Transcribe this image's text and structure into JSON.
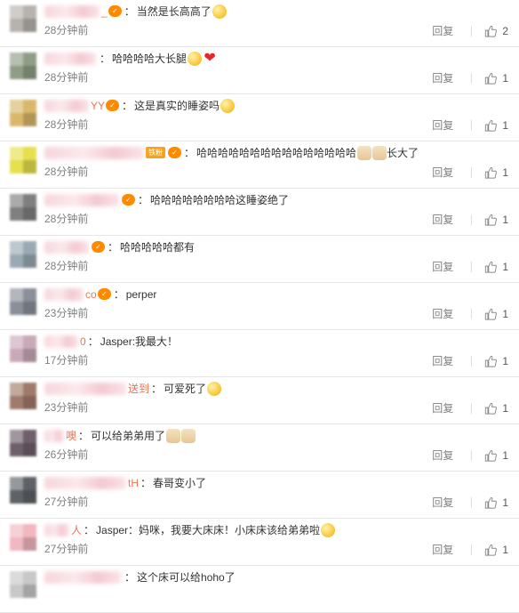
{
  "comments": [
    {
      "name_tail": "_",
      "badge": "✓",
      "text": "当然是长高高了",
      "emoji": [
        "face"
      ],
      "time": "28分钟前",
      "reply": "回复",
      "likes": "2",
      "avatar": "#b7b2ad",
      "name_w": 62
    },
    {
      "name_tail": "",
      "badge": "",
      "text": "哈哈哈哈大长腿",
      "emoji": [
        "face",
        "heart"
      ],
      "time": "28分钟前",
      "reply": "回复",
      "likes": "1",
      "avatar": "#8f9d86",
      "name_w": 58
    },
    {
      "name_tail": "YY",
      "badge": "✓",
      "text": "这是真实的睡姿吗",
      "emoji": [
        "face"
      ],
      "time": "28分钟前",
      "reply": "回复",
      "likes": "1",
      "avatar": "#d9b86b",
      "name_w": 50
    },
    {
      "name_tail": "",
      "badge": "✓",
      "fan": "铁粉",
      "text": "哈哈哈哈哈哈哈哈哈哈哈哈哈哈哈",
      "emoji": [
        "cat",
        "cat"
      ],
      "after": "长大了",
      "time": "28分钟前",
      "reply": "回复",
      "likes": "1",
      "avatar": "#e6e04e",
      "name_w": 112
    },
    {
      "name_tail": "",
      "badge": "✓",
      "text": "哈哈哈哈哈哈哈哈这睡姿绝了",
      "emoji": [],
      "time": "28分钟前",
      "reply": "回复",
      "likes": "1",
      "avatar": "#7f7f7f",
      "name_w": 84
    },
    {
      "name_tail": "",
      "badge": "✓",
      "text": "哈哈哈哈哈都有",
      "emoji": [],
      "time": "28分钟前",
      "reply": "回复",
      "likes": "1",
      "avatar": "#9aa9b3",
      "name_w": 50
    },
    {
      "name_tail": "co",
      "badge": "✓",
      "text": "perper",
      "emoji": [],
      "time": "23分钟前",
      "reply": "回复",
      "likes": "1",
      "avatar": "#8a8f99",
      "name_w": 44
    },
    {
      "name_tail": "0",
      "badge": "",
      "text": "Jasper:我最大！",
      "emoji": [],
      "time": "17分钟前",
      "reply": "回复",
      "likes": "1",
      "avatar": "#c9a9b8",
      "name_w": 38
    },
    {
      "name_tail": "送到",
      "badge": "",
      "text": "可爱死了",
      "emoji": [
        "face"
      ],
      "time": "23分钟前",
      "reply": "回复",
      "likes": "1",
      "avatar": "#a07b6b",
      "name_w": 92
    },
    {
      "name_tail": "噢",
      "badge": "",
      "text": "可以给弟弟用了",
      "emoji": [
        "cat",
        "cat"
      ],
      "time": "26分钟前",
      "reply": "回复",
      "likes": "1",
      "avatar": "#6e5f6b",
      "name_w": 22
    },
    {
      "name_tail": "tH",
      "badge": "",
      "text": "春哥变小了",
      "emoji": [],
      "time": "27分钟前",
      "reply": "回复",
      "likes": "1",
      "avatar": "#5e6266",
      "name_w": 92
    },
    {
      "name_tail": "人",
      "badge": "",
      "text": "Jasper：妈咪，我要大床床！小床床该给弟弟啦",
      "emoji": [
        "face"
      ],
      "time": "27分钟前",
      "reply": "回复",
      "likes": "1",
      "avatar": "#f2b7c0",
      "name_w": 28
    },
    {
      "name_tail": "",
      "badge": "",
      "text": "这个床可以给hoho了",
      "emoji": [],
      "time": "",
      "reply": "",
      "likes": "",
      "avatar": "#c8c8c8",
      "name_w": 86
    }
  ],
  "icons": {
    "like": "thumbs-up-icon",
    "badge": "member-badge-icon"
  },
  "colors": {
    "link": "#eb7350",
    "meta": "#808080",
    "divider": "#e6e6e6"
  }
}
